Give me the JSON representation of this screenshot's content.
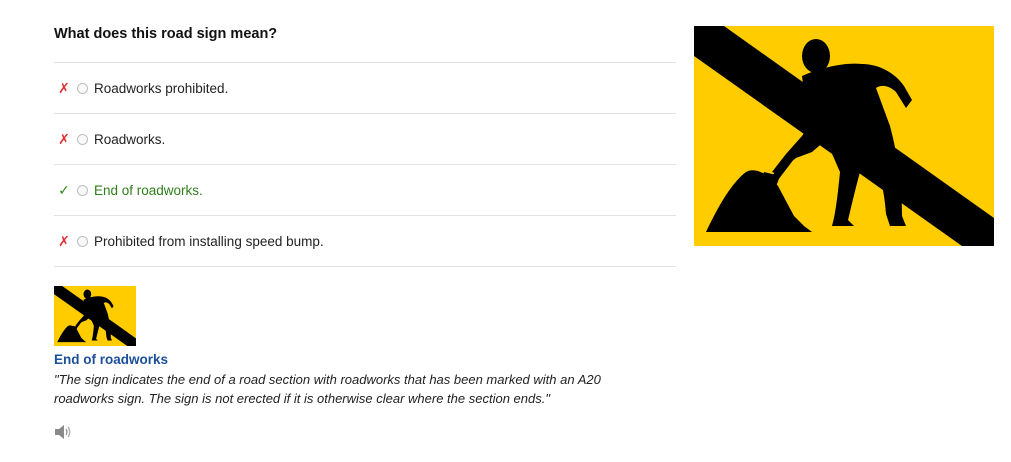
{
  "question": {
    "text": "What does this road sign mean?"
  },
  "options": [
    {
      "mark": "✗",
      "status": "wrong",
      "label": "Roadworks prohibited."
    },
    {
      "mark": "✗",
      "status": "wrong",
      "label": "Roadworks."
    },
    {
      "mark": "✓",
      "status": "correct",
      "label": "End of roadworks."
    },
    {
      "mark": "✗",
      "status": "wrong",
      "label": "Prohibited from installing speed bump."
    }
  ],
  "sign": {
    "icon": "end-of-roadworks-sign",
    "background_color": "#ffcc00",
    "symbol_color": "#000000"
  },
  "explanation": {
    "title": "End of roadworks",
    "text": "\"The sign indicates the end of a road section with roadworks that has been marked with an A20 roadworks sign. The sign is not erected if it is otherwise clear where the section ends.\""
  },
  "audio": {
    "icon": "speaker-icon"
  },
  "colors": {
    "wrong": "#e0302f",
    "correct": "#2e7d1a",
    "title_link": "#1b4f9c"
  }
}
